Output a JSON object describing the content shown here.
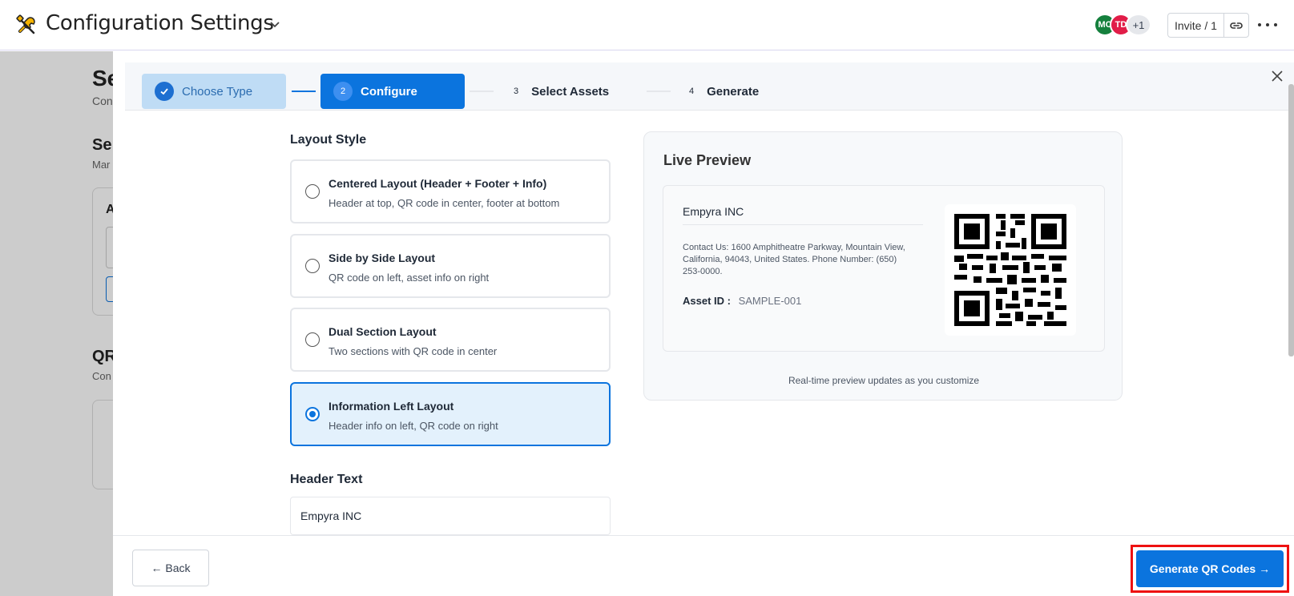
{
  "app": {
    "title": "Configuration Settings",
    "icon": "tools-icon"
  },
  "header": {
    "avatars": [
      "MC",
      "TD",
      "+1"
    ],
    "invite_label": "Invite / 1"
  },
  "background": {
    "fragments": [
      "Se",
      "Con",
      "Se",
      "Mar",
      "A",
      "QR",
      "Con"
    ]
  },
  "stepper": {
    "steps": [
      {
        "number": "✓",
        "label": "Choose Type",
        "state": "done"
      },
      {
        "number": "2",
        "label": "Configure",
        "state": "active"
      },
      {
        "number": "3",
        "label": "Select Assets",
        "state": "upcoming"
      },
      {
        "number": "4",
        "label": "Generate",
        "state": "upcoming"
      }
    ]
  },
  "layout_style": {
    "label": "Layout Style",
    "options": [
      {
        "title": "Centered Layout (Header + Footer + Info)",
        "description": "Header at top, QR code in center, footer at bottom",
        "selected": false
      },
      {
        "title": "Side by Side Layout",
        "description": "QR code on left, asset info on right",
        "selected": false
      },
      {
        "title": "Dual Section Layout",
        "description": "Two sections with QR code in center",
        "selected": false
      },
      {
        "title": "Information Left Layout",
        "description": "Header info on left, QR code on right",
        "selected": true
      }
    ]
  },
  "header_text": {
    "label": "Header Text",
    "value": "Empyra INC"
  },
  "preview": {
    "title": "Live Preview",
    "header": "Empyra INC",
    "contact": "Contact Us: 1600 Amphitheatre Parkway, Mountain View, California, 94043, United States. Phone Number: (650) 253-0000.",
    "asset_label": "Asset ID :",
    "asset_value": "SAMPLE-001",
    "note": "Real-time preview updates as you customize"
  },
  "footer": {
    "back_label": "← Back",
    "generate_label": "Generate QR Codes →"
  },
  "colors": {
    "primary": "#0b74de",
    "step_done_bg": "#bfdcf5",
    "highlight": "#ee1111"
  }
}
